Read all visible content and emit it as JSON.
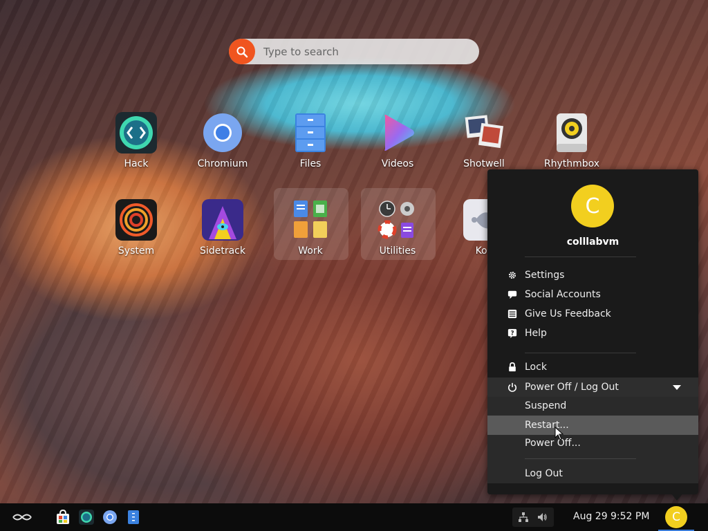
{
  "search": {
    "placeholder": "Type to search"
  },
  "desktop": {
    "apps": [
      {
        "label": "Hack",
        "icon": "hack-icon"
      },
      {
        "label": "Chromium",
        "icon": "chromium-icon"
      },
      {
        "label": "Files",
        "icon": "files-icon"
      },
      {
        "label": "Videos",
        "icon": "videos-icon"
      },
      {
        "label": "Shotwell",
        "icon": "shotwell-icon"
      },
      {
        "label": "Rhythmbox",
        "icon": "rhythmbox-icon"
      },
      {
        "label": "System",
        "icon": "system-icon"
      },
      {
        "label": "Sidetrack",
        "icon": "sidetrack-icon"
      },
      {
        "label": "Work",
        "icon": "work-folder-icon"
      },
      {
        "label": "Utilities",
        "icon": "utilities-folder-icon"
      },
      {
        "label": "Koli",
        "icon": "kolibri-icon"
      }
    ]
  },
  "user_menu": {
    "avatar_letter": "C",
    "username": "colllabvm",
    "items": [
      {
        "label": "Settings",
        "icon": "gear-icon"
      },
      {
        "label": "Social Accounts",
        "icon": "chat-bubble-icon"
      },
      {
        "label": "Give Us Feedback",
        "icon": "feedback-icon"
      },
      {
        "label": "Help",
        "icon": "help-icon"
      },
      {
        "label": "Lock",
        "icon": "lock-icon"
      },
      {
        "label": "Power Off / Log Out",
        "icon": "power-icon"
      }
    ],
    "power_submenu": [
      {
        "label": "Suspend"
      },
      {
        "label": "Restart..."
      },
      {
        "label": "Power Off..."
      },
      {
        "label": "Log Out"
      }
    ]
  },
  "taskbar": {
    "pinned": [
      "app-store-icon",
      "hack-icon",
      "chromium-icon",
      "files-icon"
    ],
    "date": "Aug 29",
    "time": "9:52 PM",
    "avatar_letter": "C"
  },
  "colors": {
    "accent_orange": "#f0551f",
    "avatar_yellow": "#f2cf1f",
    "menu_bg": "#1a1a1a",
    "hover_bg": "#5a5a5a"
  }
}
